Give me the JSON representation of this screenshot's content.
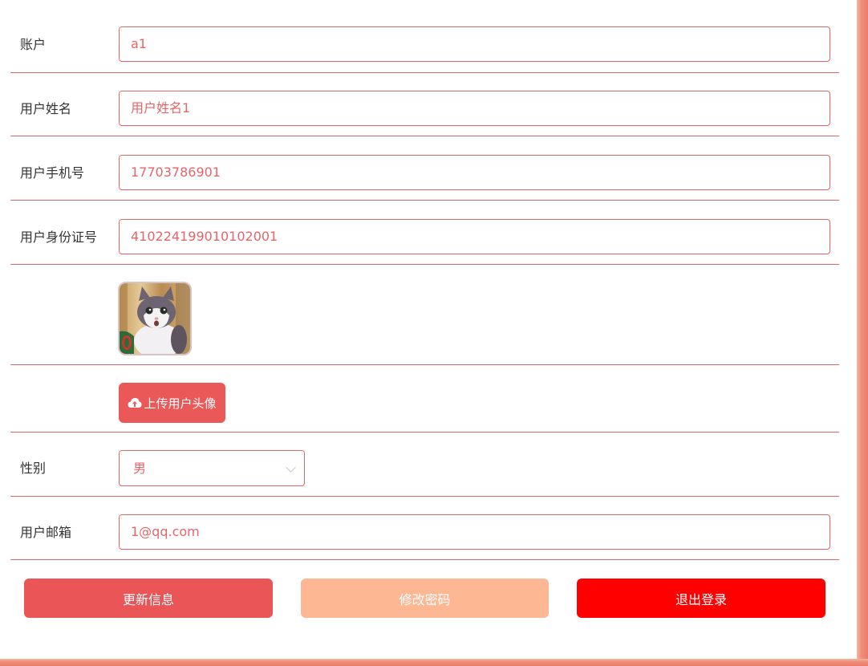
{
  "form": {
    "account": {
      "label": "账户",
      "value": "a1"
    },
    "name": {
      "label": "用户姓名",
      "value": "用户姓名1"
    },
    "phone": {
      "label": "用户手机号",
      "value": "17703786901"
    },
    "id_card": {
      "label": "用户身份证号",
      "value": "410224199010102001"
    },
    "avatar": {
      "icon": "cat-avatar-image"
    },
    "upload": {
      "label": "上传用户头像",
      "icon": "cloud-upload-icon"
    },
    "gender": {
      "label": "性别",
      "value": "男"
    },
    "email": {
      "label": "用户邮箱",
      "value": "1@qq.com"
    }
  },
  "actions": {
    "update": "更新信息",
    "change_password": "修改密码",
    "logout": "退出登录"
  },
  "colors": {
    "accent": "#e5656a",
    "upload_button": "#ea5858",
    "update_button": "#ea5558",
    "password_button": "#fdb793",
    "logout_button": "#ff0000",
    "frame": "#ef8e7a"
  }
}
